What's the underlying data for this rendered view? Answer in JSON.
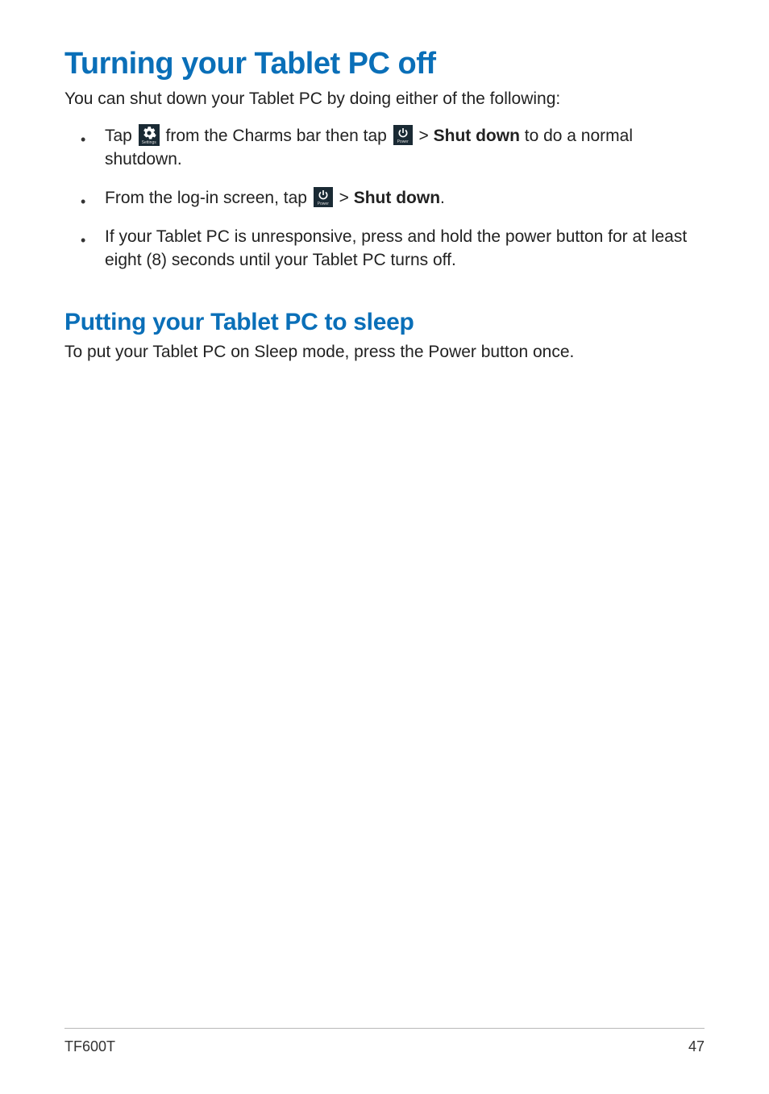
{
  "headings": {
    "title": "Turning your Tablet PC off",
    "subheading": "Putting your Tablet PC to sleep"
  },
  "intro": "You can shut down your Tablet PC by doing either of the following:",
  "bullets": {
    "b1": {
      "pre": "Tap ",
      "settingsLabel": "Settings",
      "mid": " from the Charms bar then tap ",
      "powerLabel": "Power",
      "sep": "  > ",
      "bold": "Shut down",
      "post": " to do a normal shutdown."
    },
    "b2": {
      "pre": "From the log-in screen, tap ",
      "powerLabel": "Power",
      "sep": "  > ",
      "bold": "Shut down",
      "post": "."
    },
    "b3": "If your Tablet PC is unresponsive, press and hold the power  button for at least eight (8) seconds until your Tablet PC turns off."
  },
  "sleepText": "To put your Tablet PC on Sleep mode, press the Power button once.",
  "footer": {
    "model": "TF600T",
    "page": "47"
  }
}
